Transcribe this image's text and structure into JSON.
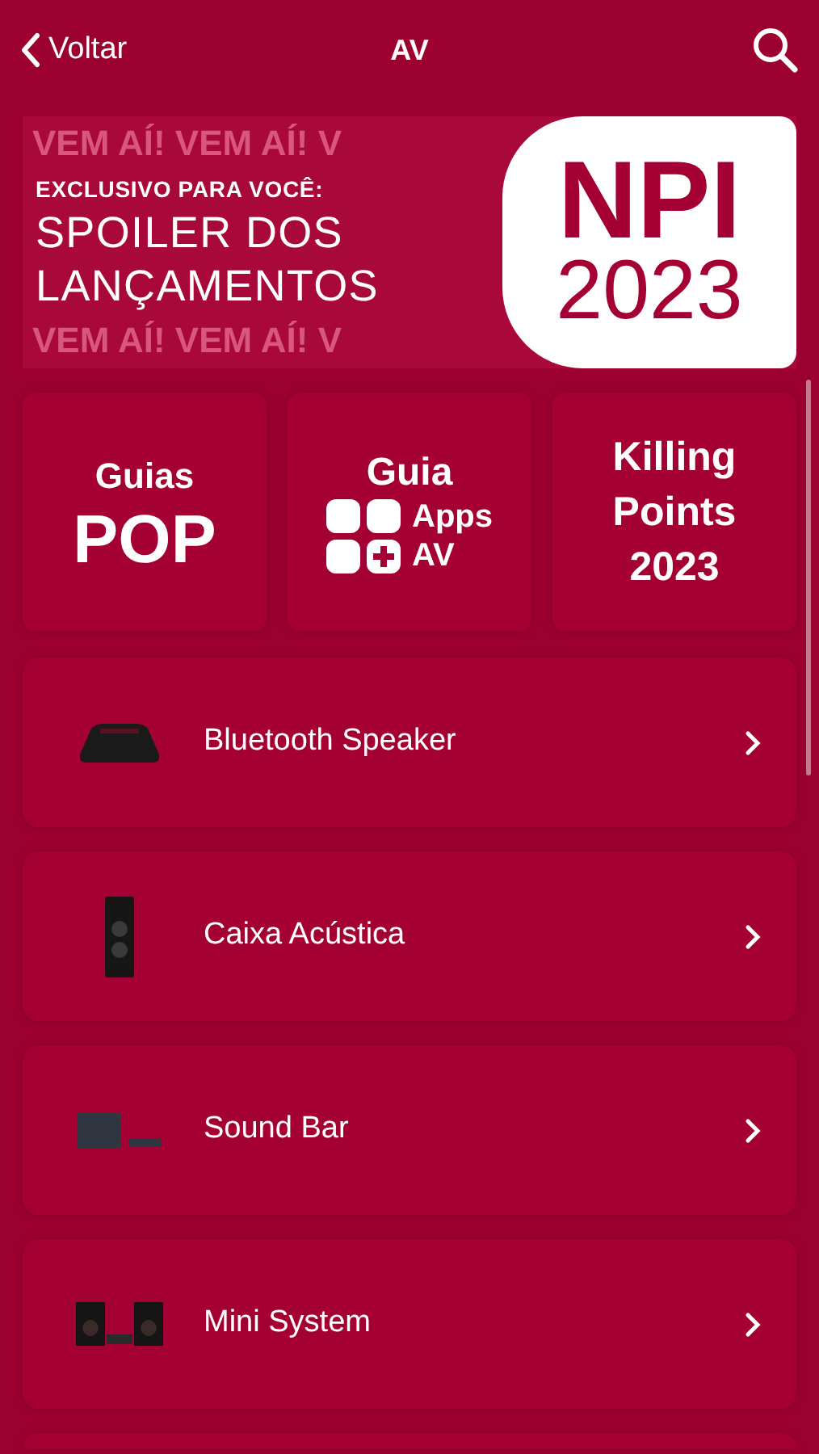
{
  "nav": {
    "back": "Voltar",
    "title": "AV"
  },
  "banner": {
    "pattern": [
      "VEM AÍ! VEM AÍ! V",
      "VEM AÍ! VEM AÍ! V"
    ],
    "kicker": "EXCLUSIVO PARA VOCÊ:",
    "headline": [
      "SPOILER DOS",
      "LANÇAMENTOS"
    ],
    "badge": [
      "NPI",
      "2023"
    ]
  },
  "tiles": [
    {
      "kind": "pop",
      "lines": [
        "Guias",
        "POP"
      ]
    },
    {
      "kind": "apps",
      "lines": [
        "Guia",
        "Apps",
        "AV"
      ]
    },
    {
      "kind": "text",
      "lines": [
        "Killing",
        "Points",
        "2023"
      ]
    }
  ],
  "categories": [
    {
      "kind": "portable",
      "label": "Bluetooth Speaker"
    },
    {
      "kind": "tower",
      "label": "Caixa Acústica"
    },
    {
      "kind": "soundbar",
      "label": "Sound Bar"
    },
    {
      "kind": "minisystem",
      "label": "Mini System"
    }
  ]
}
